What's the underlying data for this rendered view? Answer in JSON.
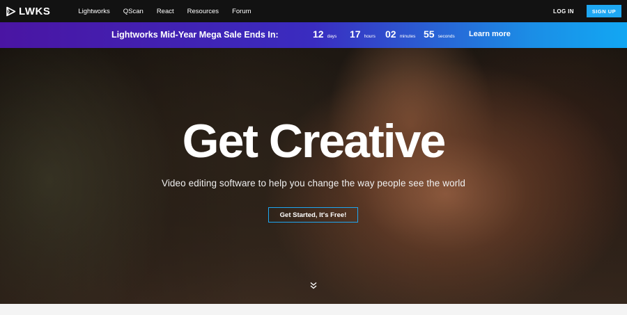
{
  "nav": {
    "logo_text": "LWKS",
    "links": [
      "Lightworks",
      "QScan",
      "React",
      "Resources",
      "Forum"
    ],
    "login_label": "LOG IN",
    "signup_label": "SIGN UP"
  },
  "banner": {
    "title": "Lightworks Mid-Year Mega Sale Ends In:",
    "countdown": [
      {
        "value": "12",
        "unit": "days"
      },
      {
        "value": "17",
        "unit": "hours"
      },
      {
        "value": "02",
        "unit": "minutes"
      },
      {
        "value": "55",
        "unit": "seconds"
      }
    ],
    "learn_more": "Learn more"
  },
  "hero": {
    "title": "Get Creative",
    "subtitle": "Video editing software to help you change the way people see the world",
    "cta_label": "Get Started, It's Free!"
  },
  "colors": {
    "accent": "#1ea7f2",
    "nav_bg": "#121212",
    "banner_start": "#4a15a3",
    "banner_end": "#12a7f3"
  },
  "icons": {
    "logo": "play-triangle-logo-icon",
    "scroll": "double-chevron-down-icon"
  }
}
